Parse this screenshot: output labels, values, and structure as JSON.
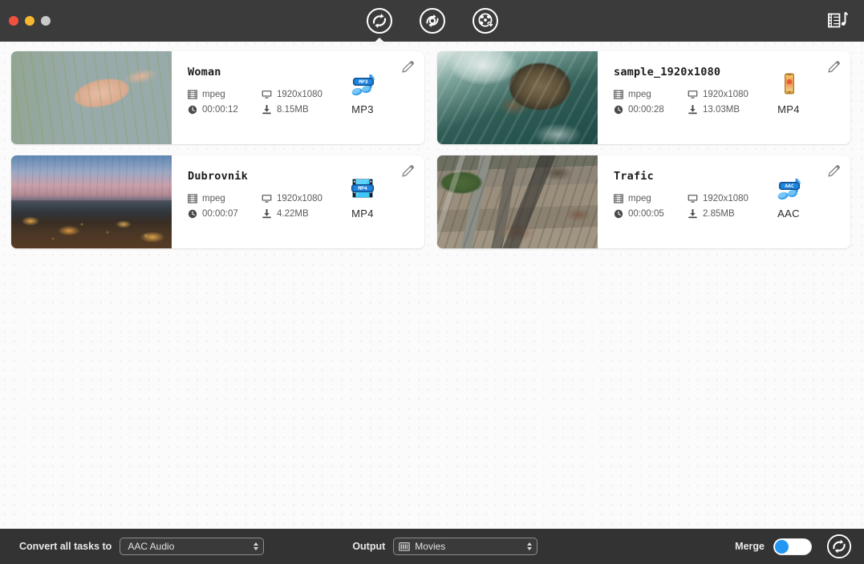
{
  "window": {
    "traffic_lights": [
      "close",
      "minimize",
      "zoom"
    ],
    "toolbar": [
      {
        "name": "convert-tab",
        "icon": "convert-circle-icon",
        "active": true
      },
      {
        "name": "record-tab",
        "icon": "record-circle-icon",
        "active": false
      },
      {
        "name": "download-tab",
        "icon": "film-download-circle-icon",
        "active": false
      }
    ],
    "toolbar_right": {
      "name": "media-library-button",
      "icon": "filmstrip-music-icon"
    }
  },
  "tasks": [
    {
      "title": "Woman",
      "codec": "mpeg",
      "resolution": "1920x1080",
      "duration": "00:00:12",
      "size": "8.15MB",
      "format": "MP3",
      "format_icon": "mp3-note-icon",
      "thumb_class": "thumb-flowers",
      "edit_icon": "pencil-icon"
    },
    {
      "title": "sample_1920x1080",
      "codec": "mpeg",
      "resolution": "1920x1080",
      "duration": "00:00:28",
      "size": "13.03MB",
      "format": "MP4",
      "format_icon": "mp4-phone-icon",
      "thumb_class": "thumb-ocean",
      "edit_icon": "pencil-icon"
    },
    {
      "title": "Dubrovnik",
      "codec": "mpeg",
      "resolution": "1920x1080",
      "duration": "00:00:07",
      "size": "4.22MB",
      "format": "MP4",
      "format_icon": "mp4-filmstrip-icon",
      "thumb_class": "thumb-dubrovnik",
      "edit_icon": "pencil-icon"
    },
    {
      "title": "Trafic",
      "codec": "mpeg",
      "resolution": "1920x1080",
      "duration": "00:00:05",
      "size": "2.85MB",
      "format": "AAC",
      "format_icon": "aac-note-icon",
      "thumb_class": "thumb-trafic",
      "edit_icon": "pencil-icon"
    }
  ],
  "bottom": {
    "convert_all_label": "Convert all tasks to",
    "convert_all_value": "AAC Audio",
    "output_label": "Output",
    "output_value": "Movies",
    "merge_label": "Merge",
    "merge_on": false,
    "convert_button_icon": "convert-circle-icon"
  },
  "colors": {
    "titlebar": "#3b3b3b",
    "bottombar": "#333333",
    "accent": "#2196f3",
    "card": "#ffffff",
    "canvas": "#fbfbfb"
  }
}
